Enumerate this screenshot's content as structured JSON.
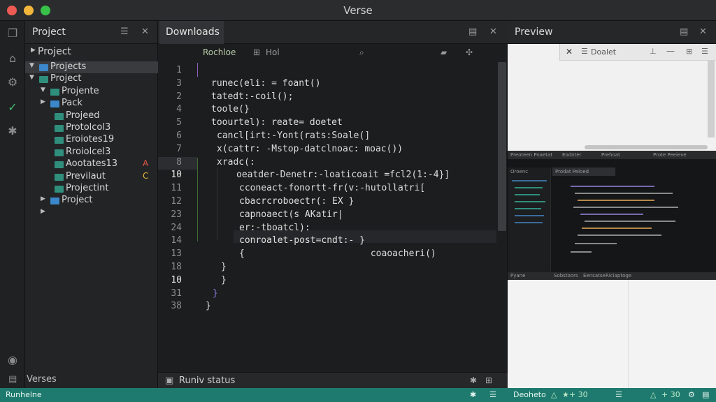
{
  "window": {
    "title": "Verse",
    "traffic": [
      "#ee5b53",
      "#f2b73a",
      "#38c24a"
    ]
  },
  "project_panel": {
    "header": "Project",
    "root": "Project",
    "items": [
      {
        "label": "Projects",
        "depth": 0,
        "arrow": "▼",
        "folder": "#3b87c9",
        "selected": true
      },
      {
        "label": "Project",
        "depth": 0,
        "arrow": "▼",
        "folder": "#2f8f7c"
      },
      {
        "label": "Projente",
        "depth": 1,
        "arrow": "▼",
        "folder": "#2f8f7c"
      },
      {
        "label": "Pack",
        "depth": 1,
        "arrow": "▶",
        "folder": "#3b87c9"
      },
      {
        "label": "Projeed",
        "depth": 2,
        "arrow": "",
        "folder": "#2f8f7c"
      },
      {
        "label": "Protolcol3",
        "depth": 2,
        "arrow": "",
        "folder": "#2f8f7c"
      },
      {
        "label": "Eroiotes19",
        "depth": 2,
        "arrow": "",
        "folder": "#2f8f7c"
      },
      {
        "label": "Rroiolcel3",
        "depth": 2,
        "arrow": "",
        "folder": "#2f8f7c"
      },
      {
        "label": "Aootates13",
        "depth": 2,
        "arrow": "",
        "folder": "#2f8f7c",
        "mark": "A",
        "mark_color": "#e05a45"
      },
      {
        "label": "Previlaut",
        "depth": 2,
        "arrow": "",
        "folder": "#2f8f7c",
        "mark": "C",
        "mark_color": "#e0b23a"
      },
      {
        "label": "Projectint",
        "depth": 2,
        "arrow": "",
        "folder": "#2f8f7c"
      },
      {
        "label": "Project",
        "depth": 1,
        "arrow": "▶",
        "folder": "#3b87c9"
      },
      {
        "label": "",
        "depth": 1,
        "arrow": "▶",
        "folder": ""
      }
    ],
    "footer": "Verses"
  },
  "editor": {
    "tab": "Downloads",
    "toolbar": {
      "left": "Rochloe",
      "middle": "Hol"
    },
    "line_numbers": [
      "1",
      "3",
      "2",
      "4",
      "5",
      "6",
      "7",
      "8",
      "10",
      "11",
      "12",
      "23",
      "24",
      "14",
      "13",
      "18",
      "10",
      "31",
      "38"
    ],
    "active_line": "10",
    "lines": [
      "",
      "runec(eli: = foant()",
      "tatedt:-coil();",
      "toole(}",
      "toourtel): reate= doetet",
      "cancl[irt:-Yont(rats:Soale(]",
      "x(cattr: -Mstop-datclnoac: moac())",
      "xradc(:",
      "oeatder-Denetr:-loaticoait =fcl2(1:-4}]",
      "cconeact-fonortt-fr(v:-hutollatri[",
      "cbacrcroboectr(: EX }",
      "capnoaect(s AKatir|",
      "er:-tboatcl):",
      "conroalet-post=cndt:- }",
      "{                       coaoacheri()",
      "}",
      "}",
      "}",
      "}"
    ],
    "status": "Runiv status"
  },
  "preview": {
    "header": "Preview",
    "doc_label": "Doalet",
    "mini": {
      "tabs": [
        "Preoteen Poaetat",
        "Eodnter",
        "Prehoat",
        "Prote Peeieve"
      ],
      "panel": "Oroenc",
      "file_tab": "Prodat Peloed",
      "footer": [
        "Pyane",
        "Sobstoors",
        "Eensatse",
        "Riciaptoge"
      ]
    },
    "footer_left": "Deoheto",
    "footer_mid": "★+ 30",
    "footer_right": "+ 30"
  },
  "statusbar": {
    "left": "Runhelne"
  }
}
